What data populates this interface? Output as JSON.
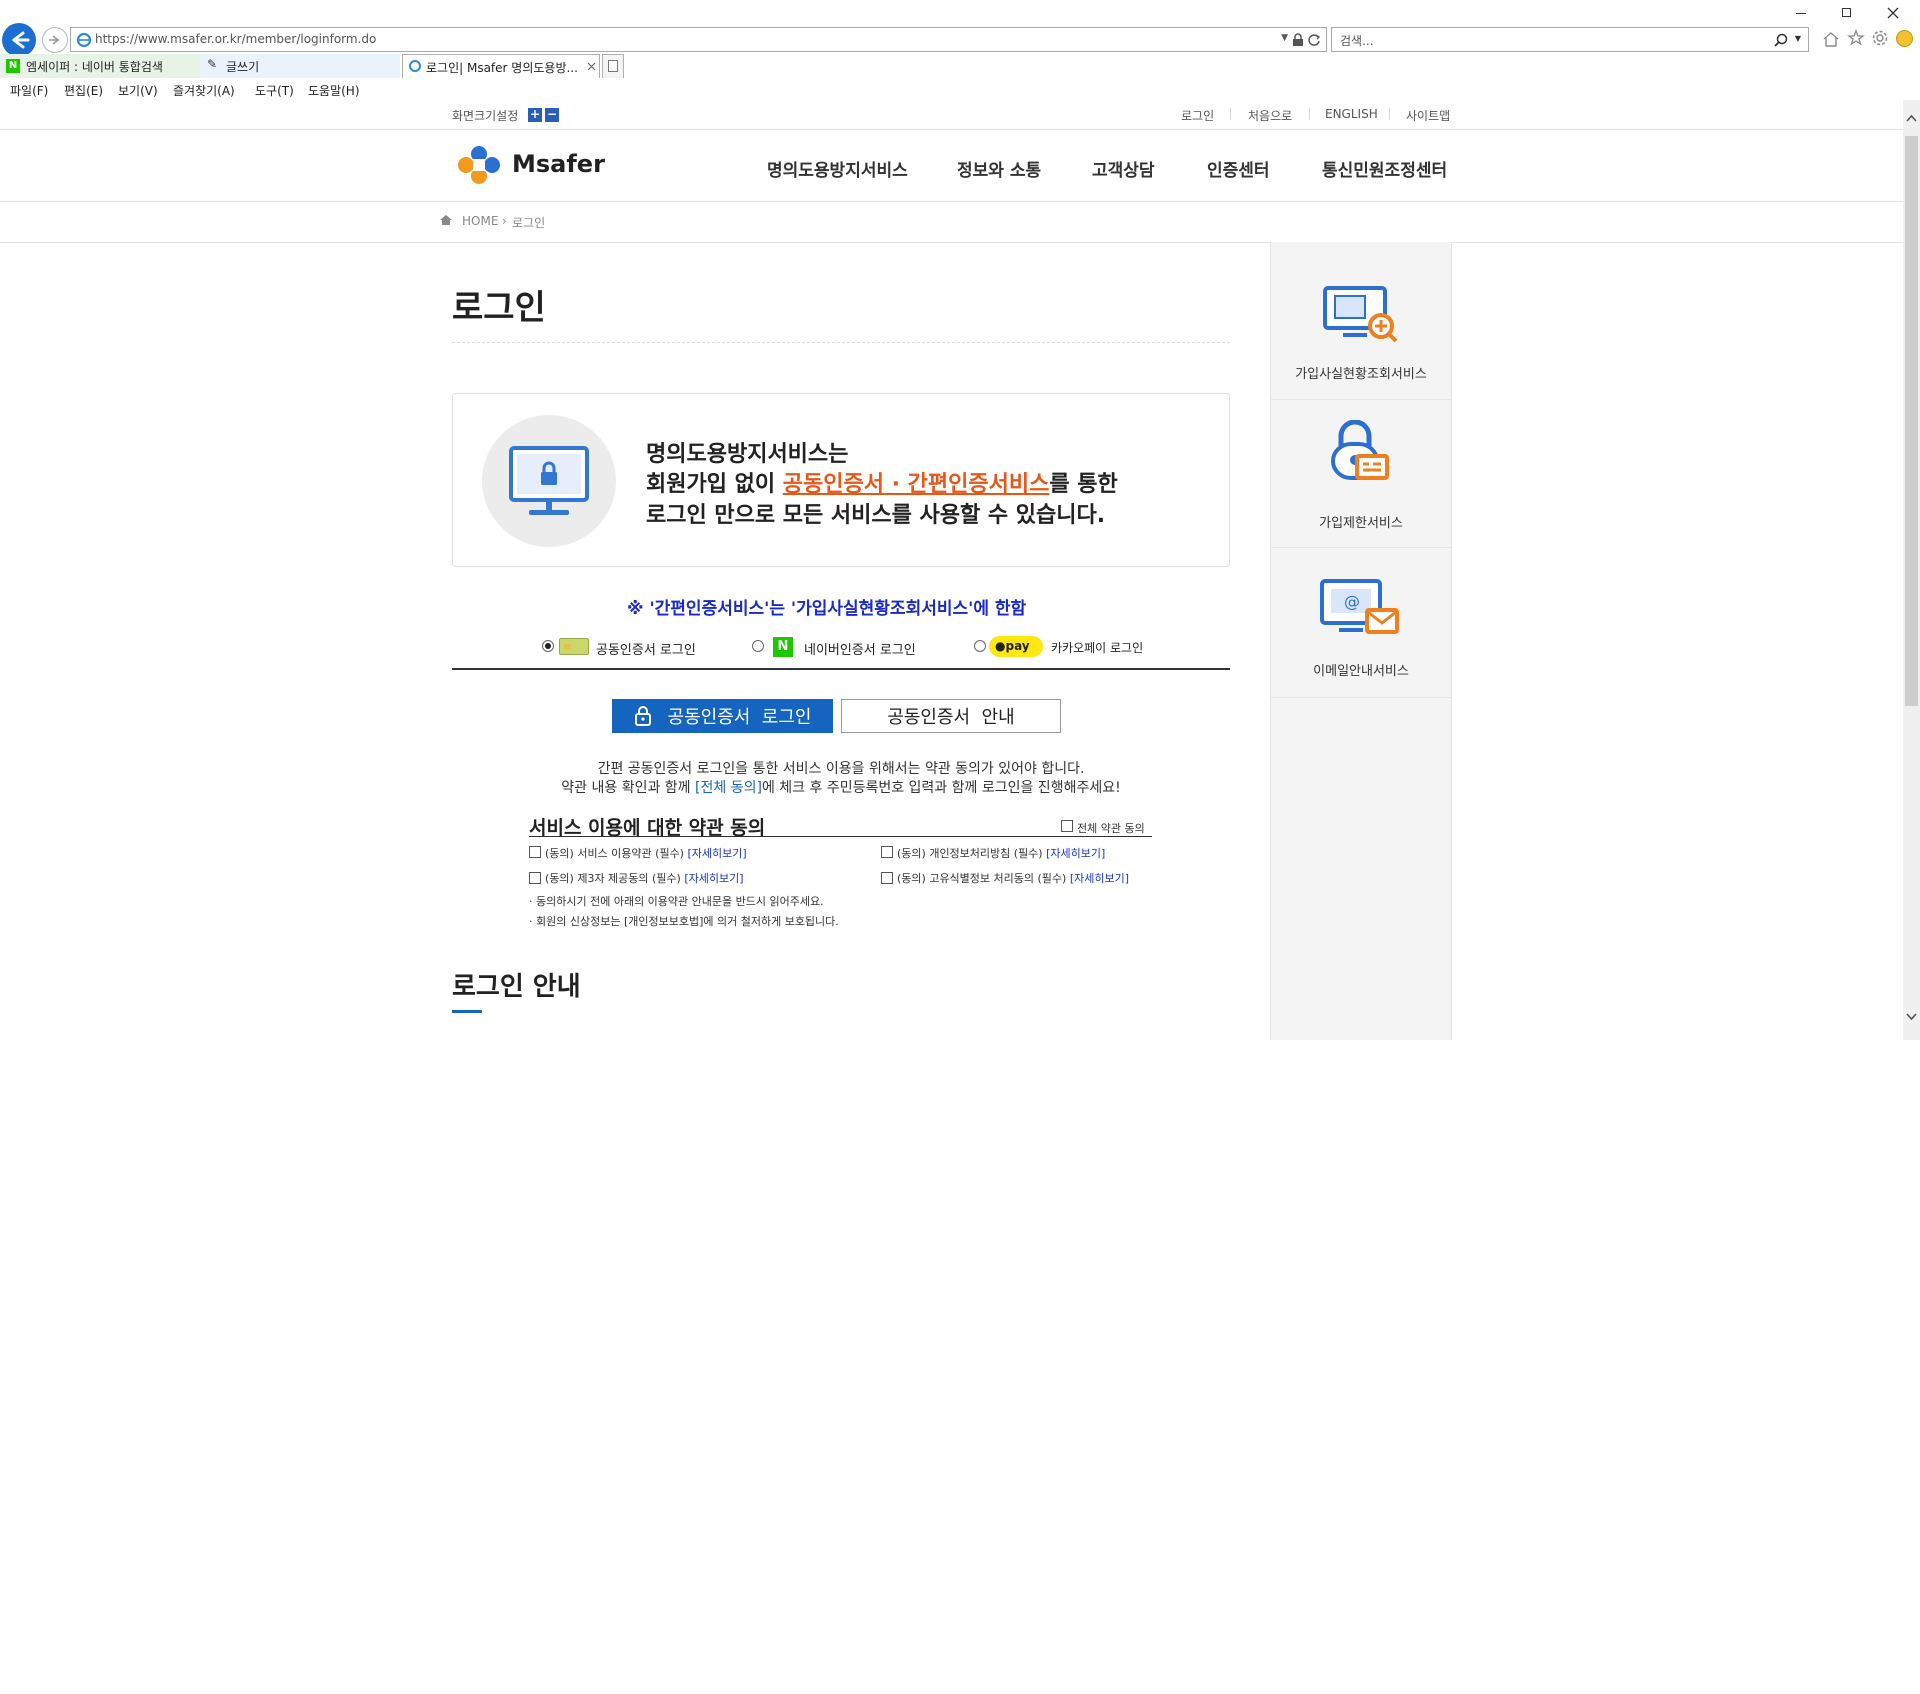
{
  "browser": {
    "url": "https://www.msafer.or.kr/member/loginform.do",
    "search_placeholder": "검색...",
    "tabs": [
      {
        "label": "엠세이퍼 : 네이버 통합검색"
      },
      {
        "label": "글쓰기"
      },
      {
        "label": "로그인| Msafer 명의도용방..."
      }
    ],
    "menu": [
      "파일(F)",
      "편집(E)",
      "보기(V)",
      "즐겨찾기(A)",
      "도구(T)",
      "도움말(H)"
    ]
  },
  "util": {
    "font_size_label": "화면크기설정",
    "links": [
      "로그인",
      "처음으로",
      "ENGLISH",
      "사이트맵"
    ]
  },
  "header": {
    "logo_text": "Msafer",
    "nav": [
      "명의도용방지서비스",
      "정보와 소통",
      "고객상담",
      "인증센터",
      "통신민원조정센터"
    ]
  },
  "breadcrumb": {
    "home": "HOME",
    "current": "로그인"
  },
  "page_title": "로그인",
  "info": {
    "line1": "명의도용방지서비스는",
    "line2_pre": "회원가입 없이 ",
    "line2_hl": "공동인증서 · 간편인증서비스",
    "line2_post": "를 통한",
    "line3": "로그인 만으로 모든 서비스를 사용할 수 있습니다."
  },
  "notice": "※ '간편인증서비스'는 '가입사실현황조회서비스'에 한함",
  "login_options": [
    {
      "label": "공동인증서 로그인",
      "selected": true
    },
    {
      "label": "네이버인증서 로그인",
      "selected": false
    },
    {
      "label": "카카오페이 로그인",
      "selected": false,
      "badge": "pay"
    }
  ],
  "buttons": {
    "cert_login": "공동인증서  로그인",
    "cert_guide": "공동인증서  안내"
  },
  "desc": {
    "line1": "간편 공동인증서 로그인을 통한 서비스 이용을 위해서는 약관 동의가 있어야 합니다.",
    "line2_pre": "약관 내용 확인과 함께 ",
    "line2_link": "[전체 동의]",
    "line2_post": "에 체크 후 주민등록번호 입력과 함께 로그인을 진행해주세요!"
  },
  "terms": {
    "title": "서비스 이용에 대한 약관 동의",
    "all_agree": "전체 약관 동의",
    "items": [
      {
        "label": "(동의) 서비스 이용약관 (필수)",
        "more": "[자세히보기]"
      },
      {
        "label": "(동의) 개인정보처리방침 (필수)",
        "more": "[자세히보기]"
      },
      {
        "label": "(동의) 제3자 제공동의 (필수)",
        "more": "[자세히보기]"
      },
      {
        "label": "(동의) 고유식별정보 처리동의 (필수)",
        "more": "[자세히보기]"
      }
    ],
    "notes": [
      "· 동의하시기 전에 아래의 이용약관 안내문을 반드시 읽어주세요.",
      "· 회원의 신상정보는 [개인정보보호법]에 의거 철저하게 보호됩니다."
    ]
  },
  "login_guide_title": "로그인 안내",
  "side_menu": [
    {
      "label": "가입사실현황조회서비스"
    },
    {
      "label": "가입제한서비스"
    },
    {
      "label": "이메일안내서비스"
    }
  ],
  "colors": {
    "primary": "#1565c0",
    "accent": "#e8571a",
    "notice": "#1a29c9"
  }
}
